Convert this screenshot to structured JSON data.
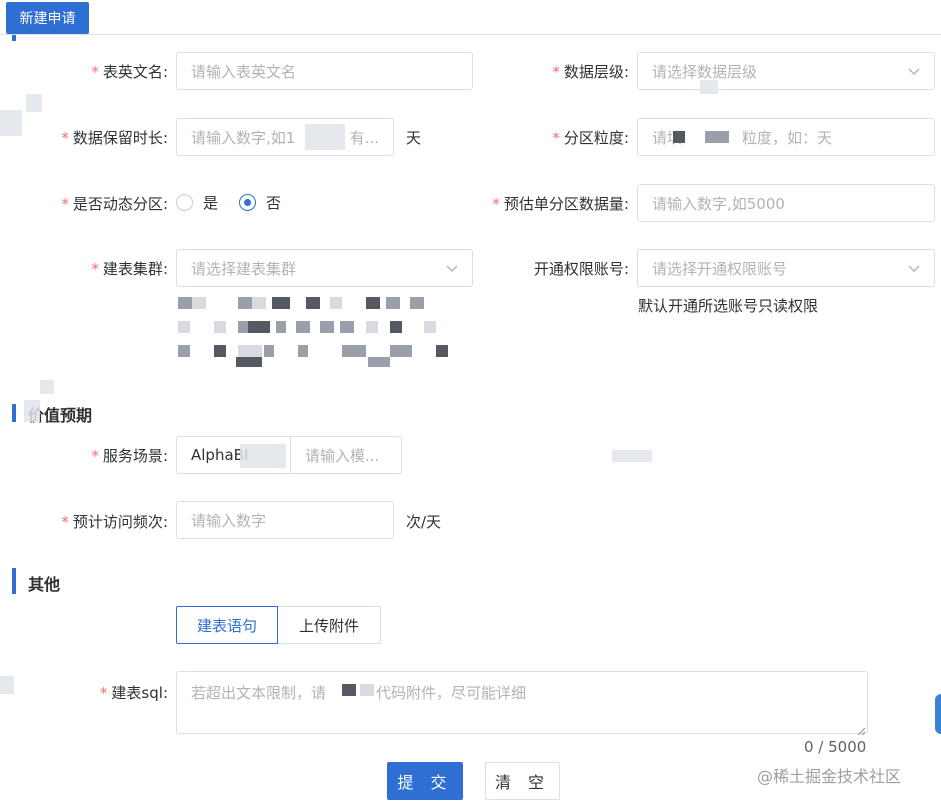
{
  "tab": {
    "label": "新建申请"
  },
  "fields": {
    "table_name": {
      "label": "表英文名",
      "required": true,
      "placeholder": "请输入表英文名"
    },
    "data_level": {
      "label": "数据层级",
      "required": true,
      "placeholder": "请选择数据层级"
    },
    "retention": {
      "label": "数据保留时长",
      "required": true,
      "placeholder": "请输入数字,如1",
      "suffix_placeholder": "有...",
      "unit": "天"
    },
    "partition": {
      "label": "分区粒度",
      "required": true,
      "placeholder": "请填",
      "placeholder_rest": "粒度，如：天"
    },
    "dynamic_partition": {
      "label": "是否动态分区",
      "required": true,
      "options": [
        "是",
        "否"
      ],
      "selected": "否"
    },
    "partition_size": {
      "label": "预估单分区数据量",
      "required": true,
      "placeholder": "请输入数字,如5000"
    },
    "cluster": {
      "label": "建表集群",
      "required": true,
      "placeholder": "请选择建表集群"
    },
    "permission": {
      "label": "开通权限账号",
      "required": false,
      "placeholder": "请选择开通权限账号",
      "hint": "默认开通所选账号只读权限"
    }
  },
  "sections": {
    "value": {
      "title": "价值预期"
    },
    "other": {
      "title": "其他"
    }
  },
  "value": {
    "scene": {
      "label": "服务场景",
      "required": true,
      "value": "AlphaBI",
      "placeholder": "请输入模..."
    },
    "frequency": {
      "label": "预计访问频次",
      "required": true,
      "placeholder": "请输入数字",
      "unit": "次/天"
    }
  },
  "other": {
    "segments": [
      "建表语句",
      "上传附件"
    ],
    "active_segment": "建表语句",
    "sql": {
      "label": "建表sql",
      "required": true,
      "placeholder": "若超出文本限制，请",
      "placeholder_rest": "代码附件，尽可能详细",
      "counter": "0 / 5000"
    }
  },
  "actions": {
    "submit": "提 交",
    "clear": "清 空"
  },
  "watermark": "@稀土掘金技术社区",
  "colors": {
    "primary": "#2f6ed2",
    "required": "#f56c6c"
  }
}
